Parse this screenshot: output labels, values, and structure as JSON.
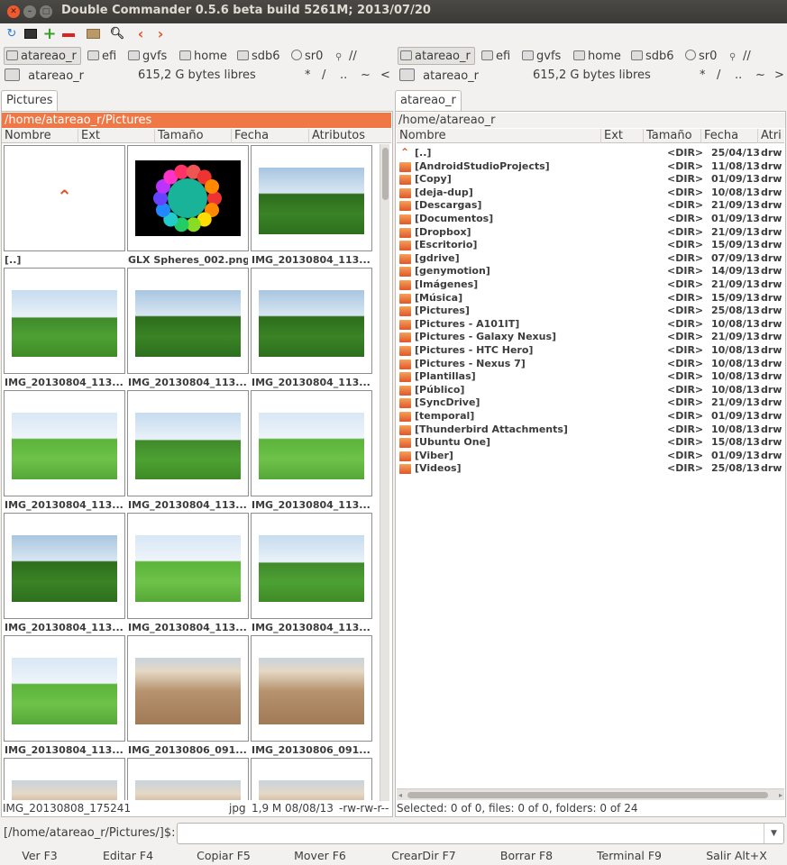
{
  "window": {
    "title": "Double Commander 0.5.6 beta build 5261M; 2013/07/20"
  },
  "toolbar": {
    "icons": [
      "refresh-icon",
      "terminal-icon",
      "add-icon",
      "remove-icon",
      "folder-icon",
      "search-icon",
      "back-icon",
      "forward-icon"
    ]
  },
  "left": {
    "drives": [
      "atareao_r",
      "efi",
      "gvfs",
      "home",
      "sdb6",
      "sr0",
      "//"
    ],
    "info": {
      "drive": "atareao_r",
      "free": "615,2 G bytes libres",
      "nav": [
        "*",
        "/",
        "..",
        "~",
        "<"
      ]
    },
    "tab": "Pictures",
    "path": "/home/atareao_r/Pictures",
    "columns": [
      "Nombre",
      "Ext",
      "Tamaño",
      "Fecha",
      "Atributos"
    ],
    "thumbs": [
      {
        "caption": "[..]",
        "kind": "up"
      },
      {
        "caption": "GLX Spheres_002.png",
        "kind": "spheres"
      },
      {
        "caption": "IMG_20130804_113...",
        "kind": "dark"
      },
      {
        "caption": "IMG_20130804_113...",
        "kind": "sky"
      },
      {
        "caption": "IMG_20130804_113...",
        "kind": "dark"
      },
      {
        "caption": "IMG_20130804_113...",
        "kind": "dark"
      },
      {
        "caption": "IMG_20130804_113...",
        "kind": "bright"
      },
      {
        "caption": "IMG_20130804_113...",
        "kind": "sky"
      },
      {
        "caption": "IMG_20130804_113...",
        "kind": "bright"
      },
      {
        "caption": "IMG_20130804_113...",
        "kind": "dark"
      },
      {
        "caption": "IMG_20130804_113...",
        "kind": "bright"
      },
      {
        "caption": "IMG_20130804_113...",
        "kind": "sky"
      },
      {
        "caption": "IMG_20130804_113...",
        "kind": "bright"
      },
      {
        "caption": "IMG_20130806_091...",
        "kind": "sand"
      },
      {
        "caption": "IMG_20130806_091...",
        "kind": "sand"
      },
      {
        "caption": "",
        "kind": "sand"
      },
      {
        "caption": "",
        "kind": "sand"
      },
      {
        "caption": "",
        "kind": "sand"
      }
    ],
    "status": {
      "name": "IMG_20130808_175241",
      "ext": "jpg",
      "size": "1,9 M",
      "date": "08/08/13",
      "attr": "-rw-rw-r--"
    }
  },
  "right": {
    "drives": [
      "atareao_r",
      "efi",
      "gvfs",
      "home",
      "sdb6",
      "sr0",
      "//"
    ],
    "info": {
      "drive": "atareao_r",
      "free": "615,2 G bytes libres",
      "nav": [
        "*",
        "/",
        "..",
        "~",
        ">"
      ]
    },
    "tab": "atareao_r",
    "path": "/home/atareao_r",
    "columns": [
      "Nombre",
      "Ext",
      "Tamaño",
      "Fecha",
      "Atri"
    ],
    "rows": [
      {
        "name": "[..]",
        "size": "<DIR>",
        "date": "25/04/13",
        "attr": "drw"
      },
      {
        "name": "[AndroidStudioProjects]",
        "size": "<DIR>",
        "date": "11/08/13",
        "attr": "drw"
      },
      {
        "name": "[Copy]",
        "size": "<DIR>",
        "date": "01/09/13",
        "attr": "drw"
      },
      {
        "name": "[deja-dup]",
        "size": "<DIR>",
        "date": "10/08/13",
        "attr": "drw"
      },
      {
        "name": "[Descargas]",
        "size": "<DIR>",
        "date": "21/09/13",
        "attr": "drw"
      },
      {
        "name": "[Documentos]",
        "size": "<DIR>",
        "date": "01/09/13",
        "attr": "drw"
      },
      {
        "name": "[Dropbox]",
        "size": "<DIR>",
        "date": "21/09/13",
        "attr": "drw"
      },
      {
        "name": "[Escritorio]",
        "size": "<DIR>",
        "date": "15/09/13",
        "attr": "drw"
      },
      {
        "name": "[gdrive]",
        "size": "<DIR>",
        "date": "07/09/13",
        "attr": "drw"
      },
      {
        "name": "[genymotion]",
        "size": "<DIR>",
        "date": "14/09/13",
        "attr": "drw"
      },
      {
        "name": "[Imágenes]",
        "size": "<DIR>",
        "date": "21/09/13",
        "attr": "drw"
      },
      {
        "name": "[Música]",
        "size": "<DIR>",
        "date": "15/09/13",
        "attr": "drw"
      },
      {
        "name": "[Pictures]",
        "size": "<DIR>",
        "date": "25/08/13",
        "attr": "drw"
      },
      {
        "name": "[Pictures - A101IT]",
        "size": "<DIR>",
        "date": "10/08/13",
        "attr": "drw"
      },
      {
        "name": "[Pictures - Galaxy Nexus]",
        "size": "<DIR>",
        "date": "21/09/13",
        "attr": "drw"
      },
      {
        "name": "[Pictures - HTC Hero]",
        "size": "<DIR>",
        "date": "10/08/13",
        "attr": "drw"
      },
      {
        "name": "[Pictures - Nexus 7]",
        "size": "<DIR>",
        "date": "10/08/13",
        "attr": "drw"
      },
      {
        "name": "[Plantillas]",
        "size": "<DIR>",
        "date": "10/08/13",
        "attr": "drw"
      },
      {
        "name": "[Público]",
        "size": "<DIR>",
        "date": "10/08/13",
        "attr": "drw"
      },
      {
        "name": "[SyncDrive]",
        "size": "<DIR>",
        "date": "21/09/13",
        "attr": "drw"
      },
      {
        "name": "[temporal]",
        "size": "<DIR>",
        "date": "01/09/13",
        "attr": "drw"
      },
      {
        "name": "[Thunderbird Attachments]",
        "size": "<DIR>",
        "date": "10/08/13",
        "attr": "drw"
      },
      {
        "name": "[Ubuntu One]",
        "size": "<DIR>",
        "date": "15/08/13",
        "attr": "drw"
      },
      {
        "name": "[Viber]",
        "size": "<DIR>",
        "date": "01/09/13",
        "attr": "drw"
      },
      {
        "name": "[Videos]",
        "size": "<DIR>",
        "date": "25/08/13",
        "attr": "drw"
      }
    ],
    "status": "Selected: 0 of 0, files: 0 of 0, folders: 0 of 24"
  },
  "cmdline": {
    "prompt": "[/home/atareao_r/Pictures/]$:",
    "value": ""
  },
  "fkeys": [
    "Ver F3",
    "Editar F4",
    "Copiar F5",
    "Mover F6",
    "CrearDir F7",
    "Borrar F8",
    "Terminal F9",
    "Salir Alt+X"
  ],
  "colors": {
    "accent": "#f07746",
    "folder": "#e8693a"
  }
}
